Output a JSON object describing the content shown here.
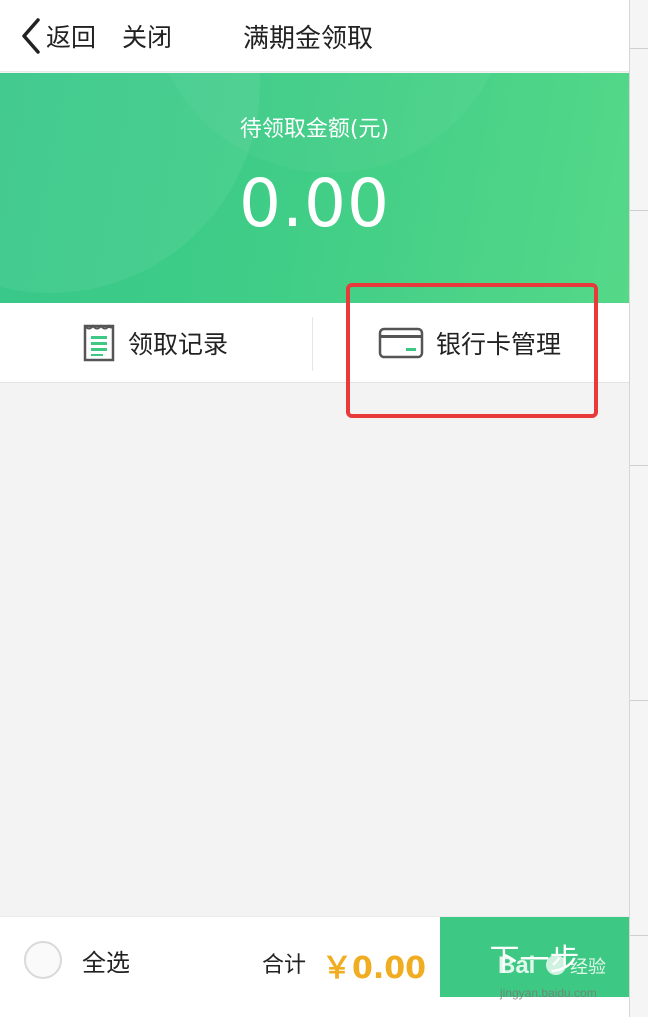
{
  "navbar": {
    "back_label": "返回",
    "close_label": "关闭",
    "title": "满期金领取"
  },
  "banner": {
    "label": "待领取金额(元)",
    "amount": "0.00"
  },
  "actions": [
    {
      "label": "领取记录",
      "icon": "receipt-icon"
    },
    {
      "label": "银行卡管理",
      "icon": "bank-card-icon"
    }
  ],
  "bottom": {
    "select_all_label": "全选",
    "total_label": "合计",
    "total_amount": "￥0.00",
    "next_label": "下一步"
  },
  "watermark": {
    "brand": "Bai",
    "brand_suffix": "经验",
    "url": "jingyan.baidu.com"
  },
  "colors": {
    "accent_green": "#3dc883",
    "amount_orange": "#f0ad22",
    "highlight_red": "#e83a3a"
  }
}
